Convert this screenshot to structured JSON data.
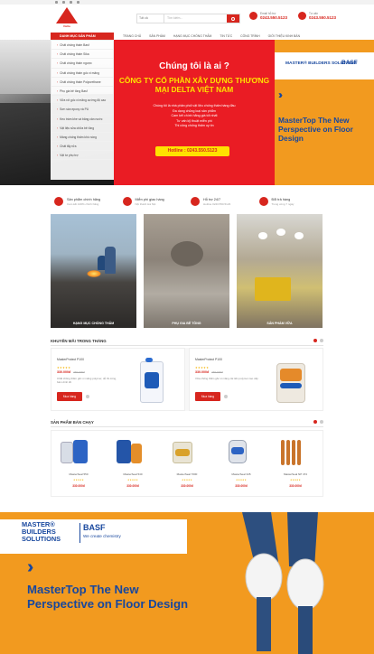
{
  "header": {
    "logo_text": "Delta",
    "search_category": "Tất cả",
    "search_placeholder": "Tìm kiếm...",
    "email_label": "Email hỗ trợ",
    "email_value": "0243.550.5123",
    "call_label": "Tư vấn",
    "call_value": "0243.550.5123",
    "colors": {
      "brand_red": "#d7261e",
      "yellow": "#ffe100",
      "orange": "#f29a1f",
      "blue": "#17479e"
    }
  },
  "nav": {
    "category_label": "DANH MỤC SẢN PHẨM",
    "items": [
      "TRANG CHỦ",
      "SẢN PHẨM",
      "HẠNG MỤC CHỐNG THẤM",
      "TIN TỨC",
      "CÔNG TRÌNH",
      "GIỚI THIỆU KINH BÁN"
    ]
  },
  "menu": {
    "items": [
      "Chất chống thấm Basf",
      "Chất chống thấm Sika",
      "Chất chống thấm ngược",
      "Chất chống thấm gốc xi măng",
      "Chất chống thấm Polyurethane",
      "Phụ gia bê tông Basf",
      "Vữa rót gốc xi măng cường độ cao",
      "Sơn sàn epoxy và PU",
      "Keo trám khe và băng cản nước",
      "Vật liệu sửa chữa bê tông",
      "Màng chống thấm khò nóng",
      "Chất tẩy rửa",
      "Vật tư phụ trợ"
    ]
  },
  "hero": {
    "title": "Chúng tôi là ai ?",
    "company": "CÔNG TY CỔ PHẦN XÂY DỰNG THƯƠNG MẠI DELTA VIỆT NAM",
    "desc": [
      "Chúng tôi là nhà phân phối vật liệu chống thấm hàng đầu",
      "Đa dạng chủng loại sản phẩm",
      "Cam kết chính hãng giá tốt nhất",
      "Tư vấn kỹ thuật miễn phí",
      "Thi công chống thấm uy tín"
    ],
    "hotline": "Hotline : 0243.550.5123",
    "ad_brand": "MASTER® BUILDERS SOLUTIONS",
    "ad_basf": "BASF",
    "ad_heading": "MasterTop The New Perspective on Floor Design"
  },
  "features": [
    {
      "title": "Sản phẩm chính hãng",
      "sub": "Cam kết 100% chính hãng"
    },
    {
      "title": "Miễn phí giao hàng",
      "sub": "Nội thành Hà Nội"
    },
    {
      "title": "Hỗ trợ 24/7",
      "sub": "Hotline 0243.550.5123"
    },
    {
      "title": "Đổi trả hàng",
      "sub": "Trong vòng 7 ngày"
    }
  ],
  "categories": [
    {
      "label": "HẠNG MỤC CHỐNG THẤM"
    },
    {
      "label": "PHỤ GIA BÊ TÔNG"
    },
    {
      "label": "SẢN PHẨM VỮA"
    }
  ],
  "promo": {
    "title": "KHUYẾN MÃI TRONG THÁNG",
    "items": [
      {
        "name": "MasterProtect P100",
        "price": "330.000đ",
        "old": "360.000đ",
        "stars": "★★★★★",
        "desc": "Chất chống thấm gốc xi măng polymer, dễ thi công, bám dính tốt",
        "buy": "Mua hàng"
      },
      {
        "name": "MasterProtect P100",
        "price": "330.000đ",
        "old": "360.000đ",
        "stars": "★★★★★",
        "desc": "Vữa chống thấm gốc xi măng cải tiến polymer cao cấp",
        "buy": "Mua hàng"
      }
    ]
  },
  "best": {
    "title": "SẢN PHẨM BÁN CHẠY",
    "items": [
      {
        "name": "MasterSeal 550",
        "stars": "★★★★★",
        "price": "330.000đ"
      },
      {
        "name": "MasterSeal 540",
        "stars": "★★★★★",
        "price": "330.000đ"
      },
      {
        "name": "MasterSeal 7000",
        "stars": "★★★★★",
        "price": "330.000đ"
      },
      {
        "name": "MasterSeal 345",
        "stars": "★★★★★",
        "price": "330.000đ"
      },
      {
        "name": "MasterSeal NP 474",
        "stars": "★★★★★",
        "price": "330.000đ"
      }
    ]
  },
  "bottom": {
    "brand": "MASTER® BUILDERS SOLUTIONS",
    "basf": "BASF",
    "basf_sub": "We create chemistry",
    "heading": "MasterTop The New Perspective on Floor Design"
  }
}
